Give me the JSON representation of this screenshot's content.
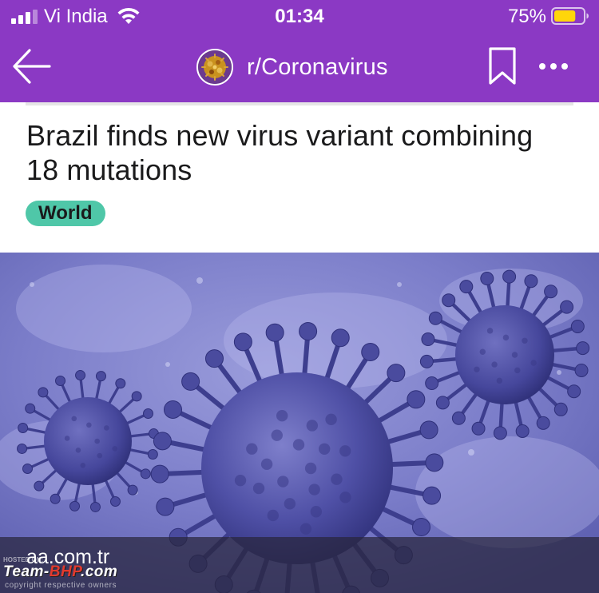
{
  "status_bar": {
    "carrier": "Vi India",
    "time": "01:34",
    "battery_percent": "75%",
    "battery_level": 0.75,
    "signal_bars_filled": 3,
    "signal_bars_total": 4
  },
  "nav": {
    "back_icon": "arrow-left-icon",
    "community_name": "r/Coronavirus",
    "bookmark_icon": "bookmark-icon",
    "more_icon": "more-horizontal-icon"
  },
  "post": {
    "title": "Brazil finds new virus variant combining 18 mutations",
    "flair": "World",
    "link_domain": "aa.com.tr"
  },
  "watermark": {
    "top_text": "HOSTED ON:",
    "brand_main": "Team-",
    "brand_accent": "BHP",
    "brand_tail": ".com",
    "sub_text": "copyright respective owners"
  },
  "colors": {
    "header_purple": "#8b39c4",
    "flair_green": "#4fc7a8",
    "image_tint": "#6a6bc0",
    "battery_yellow": "#ffd60a"
  }
}
